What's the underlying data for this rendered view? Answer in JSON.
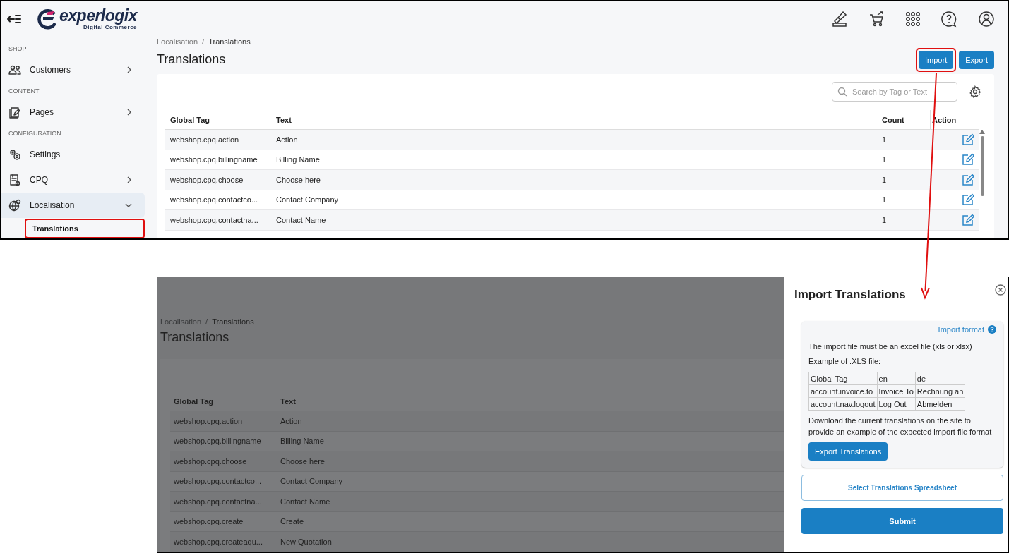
{
  "top_screen": {
    "header": {
      "logo": {
        "name": "experlogix",
        "tagline": "Digital Commerce"
      }
    },
    "sidebar": {
      "sections": [
        {
          "heading": "SHOP",
          "items": [
            {
              "label": "Customers",
              "kind": "group",
              "expanded": false,
              "selected": false
            }
          ]
        },
        {
          "heading": "CONTENT",
          "items": [
            {
              "label": "Pages",
              "kind": "group",
              "expanded": false,
              "selected": false
            }
          ]
        },
        {
          "heading": "CONFIGURATION",
          "items": [
            {
              "label": "Settings",
              "kind": "link",
              "selected": false
            },
            {
              "label": "CPQ",
              "kind": "group",
              "expanded": false,
              "selected": false
            },
            {
              "label": "Localisation",
              "kind": "group",
              "expanded": true,
              "selected": true,
              "children": [
                {
                  "label": "Translations",
                  "selected": true,
                  "highlighted": true
                }
              ]
            }
          ]
        }
      ]
    },
    "breadcrumb": {
      "items": [
        "Localisation",
        "Translations"
      ],
      "separator": "/"
    },
    "title": "Translations",
    "buttons": [
      {
        "label": "Import",
        "highlighted": true
      },
      {
        "label": "Export",
        "highlighted": false
      }
    ],
    "search": {
      "placeholder": "Search by Tag or Text"
    },
    "table": {
      "columns": [
        "Global Tag",
        "Text",
        "Count",
        "Action"
      ],
      "rows": [
        {
          "global_tag": "webshop.cpq.action",
          "text": "Action",
          "count": "1"
        },
        {
          "global_tag": "webshop.cpq.billingname",
          "text": "Billing Name",
          "count": "1"
        },
        {
          "global_tag": "webshop.cpq.choose",
          "text": "Choose here",
          "count": "1"
        },
        {
          "global_tag": "webshop.cpq.contactco...",
          "text": "Contact Company",
          "count": "1"
        },
        {
          "global_tag": "webshop.cpq.contactna...",
          "text": "Contact Name",
          "count": "1"
        }
      ]
    }
  },
  "bottom_screen": {
    "dimmed": true,
    "breadcrumb": {
      "items": [
        "Localisation",
        "Translations"
      ],
      "separator": "/"
    },
    "title": "Translations",
    "table": {
      "columns": [
        "Global Tag",
        "Text"
      ],
      "rows": [
        {
          "global_tag": "webshop.cpq.action",
          "text": "Action"
        },
        {
          "global_tag": "webshop.cpq.billingname",
          "text": "Billing Name"
        },
        {
          "global_tag": "webshop.cpq.choose",
          "text": "Choose here"
        },
        {
          "global_tag": "webshop.cpq.contactco...",
          "text": "Contact Company"
        },
        {
          "global_tag": "webshop.cpq.contactna...",
          "text": "Contact Name"
        },
        {
          "global_tag": "webshop.cpq.create",
          "text": "Create"
        },
        {
          "global_tag": "webshop.cpq.createaqu...",
          "text": "New Quotation"
        }
      ]
    },
    "drawer": {
      "title": "Import Translations",
      "format_link": "Import format",
      "intro": "The import file must be an excel file (xls or xlsx)",
      "example_label": "Example of .XLS file:",
      "example_table": [
        [
          "Global Tag",
          "en",
          "de"
        ],
        [
          "account.invoice.to",
          "Invoice To",
          "Rechnung an"
        ],
        [
          "account.nav.logout",
          "Log Out",
          "Abmelden"
        ]
      ],
      "note": "Download the current translations on the site to provide an example of the expected import file format",
      "export_button": "Export Translations",
      "select_button": "Select Translations Spreadsheet",
      "submit_button": "Submit"
    }
  }
}
